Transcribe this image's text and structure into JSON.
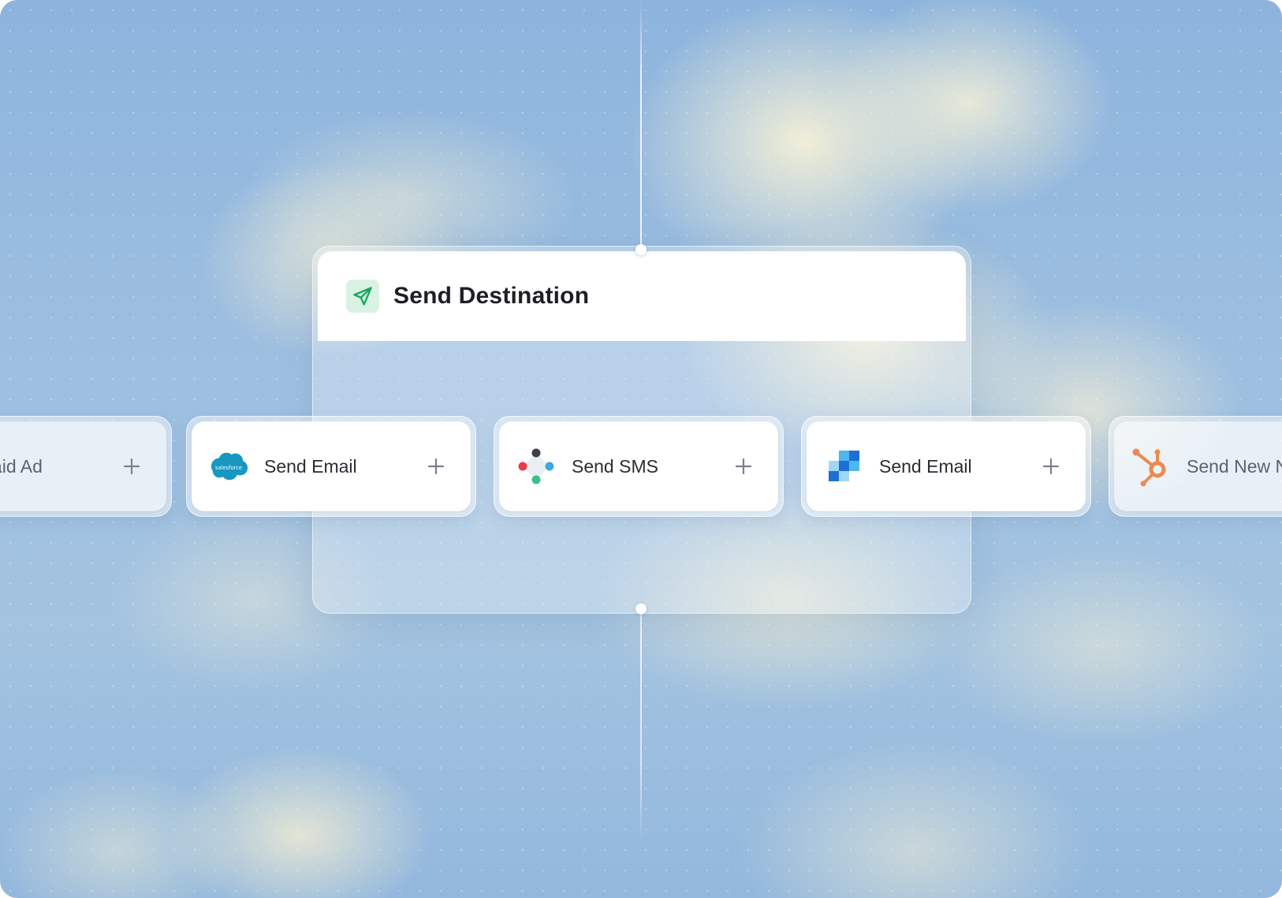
{
  "destination": {
    "title": "Send Destination",
    "icon": "paper-plane-icon",
    "icon_color": "#1aa561",
    "icon_bg": "#d8f3e3"
  },
  "cards": [
    {
      "label": "at Paid Ad",
      "logo": "paid-ad-logo",
      "faded": true
    },
    {
      "label": "Send Email",
      "logo": "salesforce-logo",
      "logo_text": "salesforce",
      "brand_color": "#1798c1"
    },
    {
      "label": "Send SMS",
      "logo": "sms-provider-logo",
      "brand_colors": [
        "#3d3f45",
        "#ea3d4a",
        "#3fa9dd",
        "#3dbf8a"
      ]
    },
    {
      "label": "Send Email",
      "logo": "email-blocks-logo",
      "brand_colors": [
        "#1d6fd6",
        "#4eb7ef",
        "#9fd8f6"
      ]
    },
    {
      "label": "Send New N",
      "logo": "hubspot-logo",
      "brand_color": "#e98b4f",
      "faded": true
    }
  ],
  "add_icon": "plus-icon"
}
